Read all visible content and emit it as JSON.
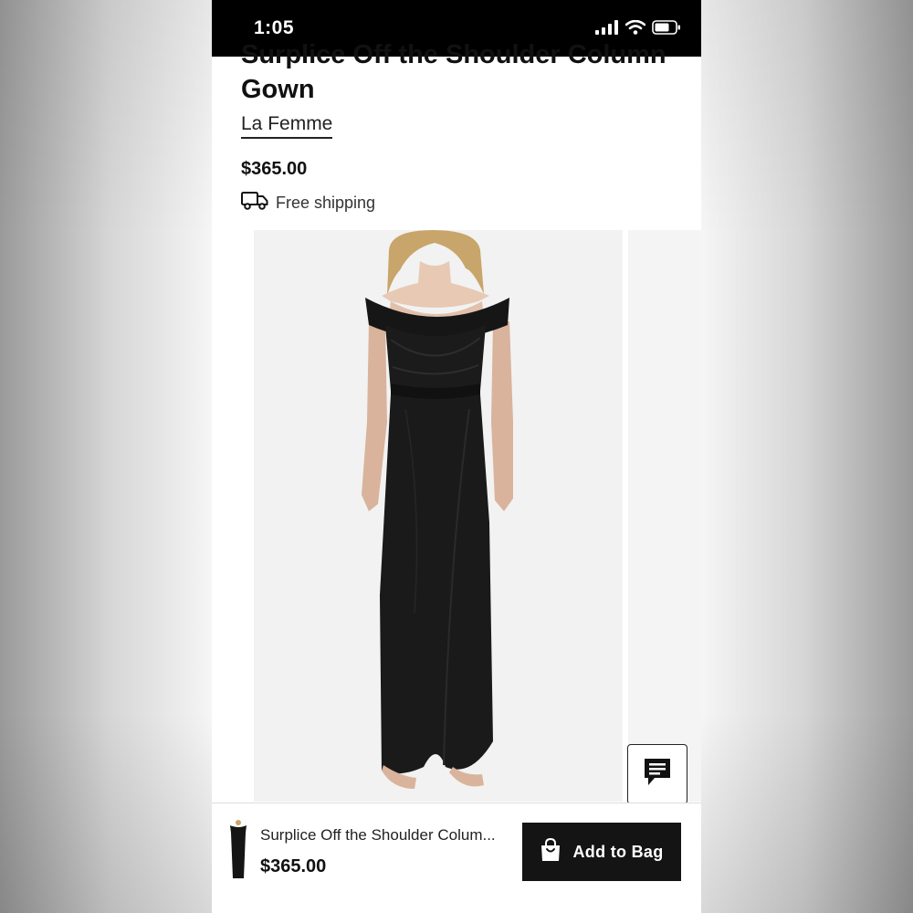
{
  "status": {
    "time": "1:05"
  },
  "product": {
    "title_line1": "Surplice Off the Shoulder Column",
    "title_line2": "Gown",
    "brand": "La Femme",
    "price": "$365.00",
    "shipping": "Free shipping"
  },
  "bottom_bar": {
    "name": "Surplice Off the Shoulder Colum...",
    "price": "$365.00",
    "add_to_bag_label": "Add to Bag"
  },
  "icons": {
    "signal": "signal-icon",
    "wifi": "wifi-icon",
    "battery": "battery-icon",
    "truck": "truck-icon",
    "chat": "chat-icon",
    "bag": "shopping-bag-icon"
  },
  "colors": {
    "status_bar": "#000000",
    "button": "#141414",
    "dress": "#1a1a1a"
  }
}
